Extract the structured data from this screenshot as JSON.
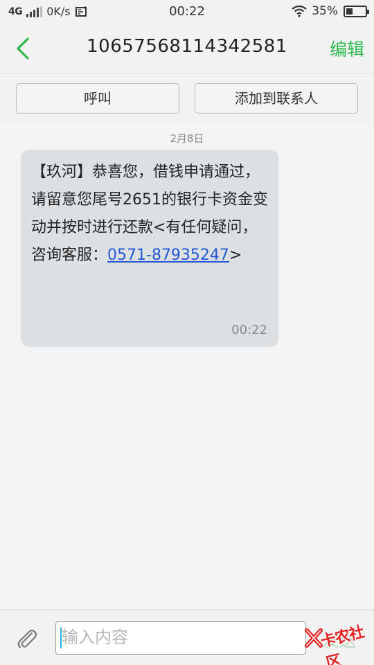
{
  "status_bar": {
    "network": "4G",
    "speed": "0K/s",
    "time": "00:22",
    "battery": "35%",
    "battery_level": 0.35
  },
  "header": {
    "title": "10657568114342581",
    "edit_label": "编辑",
    "accent_color": "#2db84e"
  },
  "actions": {
    "call_label": "呼叫",
    "add_contact_label": "添加到联系人"
  },
  "conversation": {
    "date": "2月8日",
    "message": {
      "text": "【玖河】恭喜您，借钱申请通过，请留意您尾号2651的银行卡资金变动并按时进行还款<有任何疑问，咨询客服：",
      "phone_link": "0571-87935247",
      "suffix": ">",
      "time": "00:22"
    }
  },
  "composer": {
    "placeholder": "输入内容",
    "send_label": "发送"
  },
  "watermark": {
    "text": "卡农社区"
  }
}
